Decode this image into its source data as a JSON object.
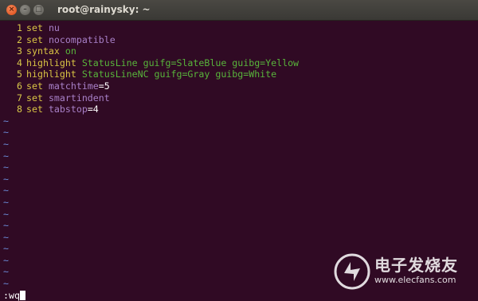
{
  "window": {
    "title": "root@rainysky: ~",
    "close_glyph": "×",
    "min_glyph": "–",
    "max_glyph": "□"
  },
  "editor": {
    "lines": [
      {
        "n": "1",
        "parts": [
          {
            "t": "set",
            "c": "kw"
          },
          {
            "t": " "
          },
          {
            "t": "nu",
            "c": "pur"
          }
        ]
      },
      {
        "n": "2",
        "parts": [
          {
            "t": "set",
            "c": "kw"
          },
          {
            "t": " "
          },
          {
            "t": "nocompatible",
            "c": "pur"
          }
        ]
      },
      {
        "n": "3",
        "parts": [
          {
            "t": "syntax",
            "c": "kw"
          },
          {
            "t": " "
          },
          {
            "t": "on",
            "c": "grn"
          }
        ]
      },
      {
        "n": "4",
        "parts": [
          {
            "t": "highlight",
            "c": "kw"
          },
          {
            "t": " "
          },
          {
            "t": "StatusLine guifg=SlateBlue guibg=Yellow",
            "c": "grn"
          }
        ]
      },
      {
        "n": "5",
        "parts": [
          {
            "t": "highlight",
            "c": "kw"
          },
          {
            "t": " "
          },
          {
            "t": "StatusLineNC guifg=Gray guibg=White",
            "c": "grn"
          }
        ]
      },
      {
        "n": "6",
        "parts": [
          {
            "t": "set",
            "c": "kw"
          },
          {
            "t": " "
          },
          {
            "t": "matchtime",
            "c": "pur"
          },
          {
            "t": "=5",
            "c": "wht"
          }
        ]
      },
      {
        "n": "7",
        "parts": [
          {
            "t": "set",
            "c": "kw"
          },
          {
            "t": " "
          },
          {
            "t": "smartindent",
            "c": "pur"
          }
        ]
      },
      {
        "n": "8",
        "parts": [
          {
            "t": "set",
            "c": "kw"
          },
          {
            "t": " "
          },
          {
            "t": "tabstop",
            "c": "pur"
          },
          {
            "t": "=4",
            "c": "wht"
          }
        ]
      }
    ],
    "empty_line_marker": "~",
    "empty_line_count": 15,
    "command_line": ":wq"
  },
  "watermark": {
    "title": "电子发烧友",
    "url": "www.elecfans.com"
  },
  "colors": {
    "background": "#300a24",
    "keyword": "#d9c444",
    "value": "#58b53b",
    "option": "#a880c8",
    "tilde": "#6b8bd8"
  }
}
